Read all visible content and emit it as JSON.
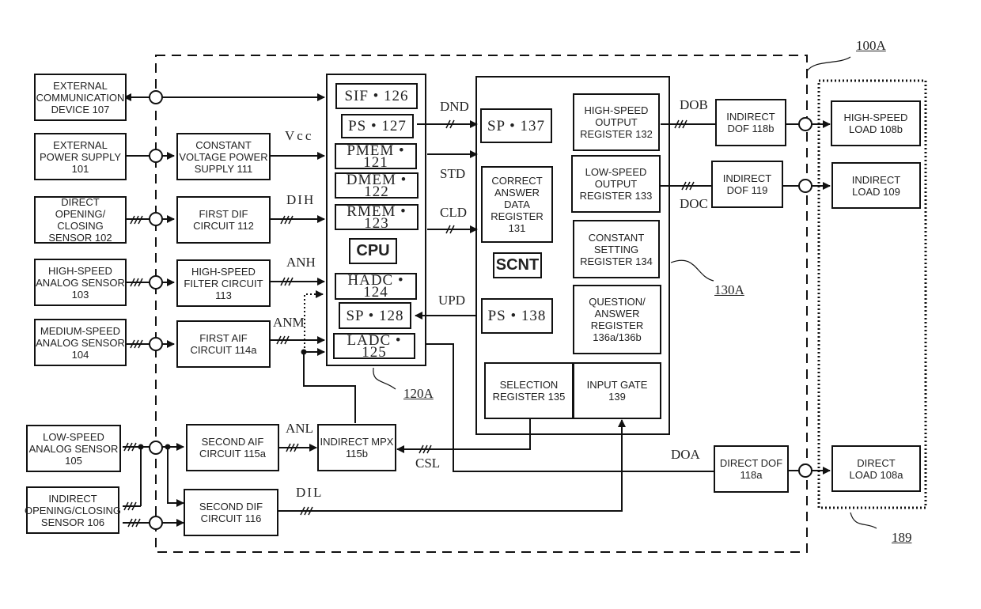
{
  "refs": {
    "system": "100A",
    "cpu_block": "120A",
    "scnt_block": "130A",
    "load_group": "189"
  },
  "external": {
    "comm": "EXTERNAL\nCOMMUNICATION\nDEVICE 107",
    "power": "EXTERNAL\nPOWER SUPPLY\n101",
    "direct_sensor": "DIRECT OPENING/\nCLOSING\nSENSOR 102",
    "hs_analog": "HIGH-SPEED\nANALOG SENSOR\n103",
    "ms_analog": "MEDIUM-SPEED\nANALOG SENSOR\n104",
    "ls_analog": "LOW-SPEED\nANALOG SENSOR\n105",
    "indirect_sensor": "INDIRECT\nOPENING/CLOSING\nSENSOR 106"
  },
  "circuits": {
    "cvps": "CONSTANT\nVOLTAGE POWER\nSUPPLY 111",
    "first_dif": "FIRST DIF\nCIRCUIT 112",
    "hs_filter": "HIGH-SPEED\nFILTER CIRCUIT\n113",
    "first_aif": "FIRST AIF\nCIRCUIT 114a",
    "second_aif": "SECOND AIF\nCIRCUIT 115a",
    "indirect_mpx": "INDIRECT MPX\n115b",
    "second_dif": "SECOND DIF\nCIRCUIT 116",
    "indirect_dof_b": "INDIRECT\nDOF 118b",
    "indirect_dof_119": "INDIRECT\nDOF 119",
    "direct_dof": "DIRECT DOF\n118a"
  },
  "cpu": {
    "label": "CPU",
    "sif": "SIF • 126",
    "ps": "PS • 127",
    "pmem": "PMEM • 121",
    "dmem": "DMEM • 122",
    "rmem": "RMEM • 123",
    "hadc": "HADC • 124",
    "sp": "SP • 128",
    "ladc": "LADC • 125"
  },
  "scnt": {
    "label": "SCNT",
    "sp": "SP • 137",
    "correct": "CORRECT\nANSWER\nDATA\nREGISTER\n131",
    "ps": "PS • 138",
    "hs_out": "HIGH-SPEED\nOUTPUT\nREGISTER 132",
    "ls_out": "LOW-SPEED\nOUTPUT\nREGISTER 133",
    "const": "CONSTANT\nSETTING\nREGISTER 134",
    "qa": "QUESTION/\nANSWER\nREGISTER\n136a/136b",
    "selection": "SELECTION\nREGISTER 135",
    "input_gate": "INPUT GATE\n139"
  },
  "loads": {
    "hs_load": "HIGH-SPEED\nLOAD 108b",
    "indirect_load": "INDIRECT\nLOAD 109",
    "direct_load": "DIRECT\nLOAD 108a"
  },
  "signals": {
    "vcc": "Vcc",
    "dih": "DIH",
    "anh": "ANH",
    "anm": "ANM",
    "anl": "ANL",
    "dil": "DIL",
    "dnd": "DND",
    "std": "STD",
    "cld": "CLD",
    "upd": "UPD",
    "csl": "CSL",
    "dob": "DOB",
    "doc": "DOC",
    "doa": "DOA"
  }
}
